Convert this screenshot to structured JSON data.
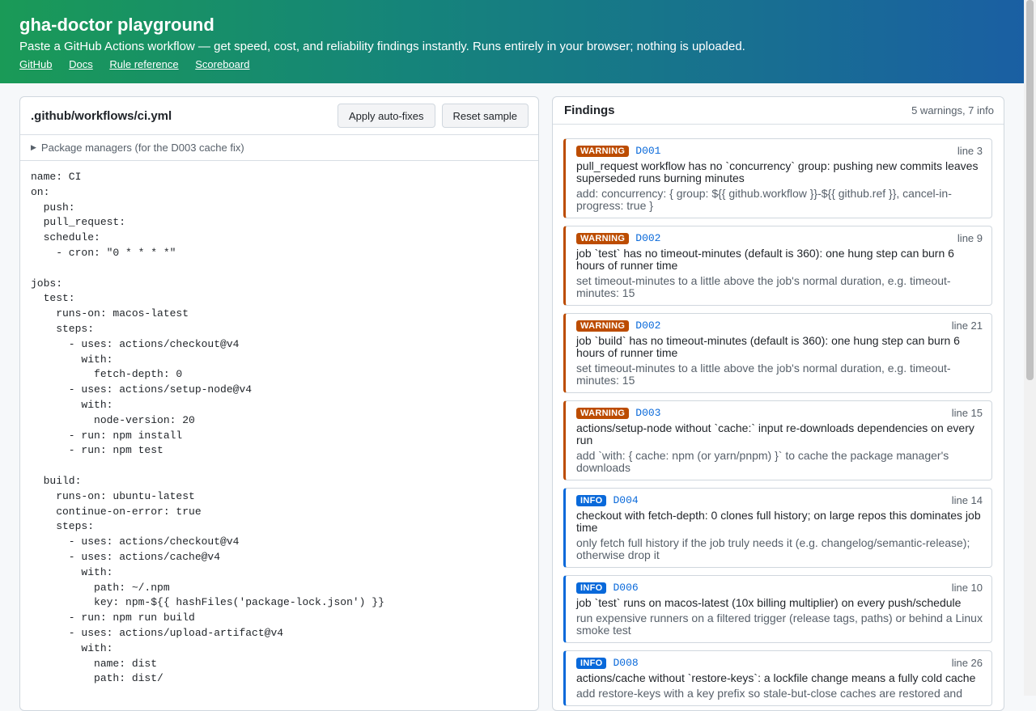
{
  "header": {
    "title": "gha-doctor playground",
    "tagline": "Paste a GitHub Actions workflow — get speed, cost, and reliability findings instantly. Runs entirely in your browser; nothing is uploaded.",
    "links": [
      "GitHub",
      "Docs",
      "Rule reference",
      "Scoreboard"
    ]
  },
  "editor": {
    "filename": ".github/workflows/ci.yml",
    "apply_label": "Apply auto-fixes",
    "reset_label": "Reset sample",
    "package_managers_label": "Package managers (for the D003 cache fix)",
    "code": "name: CI\non:\n  push:\n  pull_request:\n  schedule:\n    - cron: \"0 * * * *\"\n\njobs:\n  test:\n    runs-on: macos-latest\n    steps:\n      - uses: actions/checkout@v4\n        with:\n          fetch-depth: 0\n      - uses: actions/setup-node@v4\n        with:\n          node-version: 20\n      - run: npm install\n      - run: npm test\n\n  build:\n    runs-on: ubuntu-latest\n    continue-on-error: true\n    steps:\n      - uses: actions/checkout@v4\n      - uses: actions/cache@v4\n        with:\n          path: ~/.npm\n          key: npm-${{ hashFiles('package-lock.json') }}\n      - run: npm run build\n      - uses: actions/upload-artifact@v4\n        with:\n          name: dist\n          path: dist/"
  },
  "findings": {
    "title": "Findings",
    "count": "5 warnings, 7 info",
    "items": [
      {
        "severity": "WARNING",
        "rule": "D001",
        "line": "line 3",
        "message": "pull_request workflow has no `concurrency` group: pushing new commits leaves superseded runs burning minutes",
        "fix": "add: concurrency: { group: ${{ github.workflow }}-${{ github.ref }}, cancel-in-progress: true }"
      },
      {
        "severity": "WARNING",
        "rule": "D002",
        "line": "line 9",
        "message": "job `test` has no timeout-minutes (default is 360): one hung step can burn 6 hours of runner time",
        "fix": "set timeout-minutes to a little above the job's normal duration, e.g. timeout-minutes: 15"
      },
      {
        "severity": "WARNING",
        "rule": "D002",
        "line": "line 21",
        "message": "job `build` has no timeout-minutes (default is 360): one hung step can burn 6 hours of runner time",
        "fix": "set timeout-minutes to a little above the job's normal duration, e.g. timeout-minutes: 15"
      },
      {
        "severity": "WARNING",
        "rule": "D003",
        "line": "line 15",
        "message": "actions/setup-node without `cache:` input re-downloads dependencies on every run",
        "fix": "add `with: { cache: npm (or yarn/pnpm) }` to cache the package manager's downloads"
      },
      {
        "severity": "INFO",
        "rule": "D004",
        "line": "line 14",
        "message": "checkout with fetch-depth: 0 clones full history; on large repos this dominates job time",
        "fix": "only fetch full history if the job truly needs it (e.g. changelog/semantic-release); otherwise drop it"
      },
      {
        "severity": "INFO",
        "rule": "D006",
        "line": "line 10",
        "message": "job `test` runs on macos-latest (10x billing multiplier) on every push/schedule",
        "fix": "run expensive runners on a filtered trigger (release tags, paths) or behind a Linux smoke test"
      },
      {
        "severity": "INFO",
        "rule": "D008",
        "line": "line 26",
        "message": "actions/cache without `restore-keys`: a lockfile change means a fully cold cache",
        "fix": "add restore-keys with a key prefix so stale-but-close caches are restored and"
      }
    ]
  },
  "colors": {
    "warning": "#bc4c00",
    "info": "#0969da"
  }
}
